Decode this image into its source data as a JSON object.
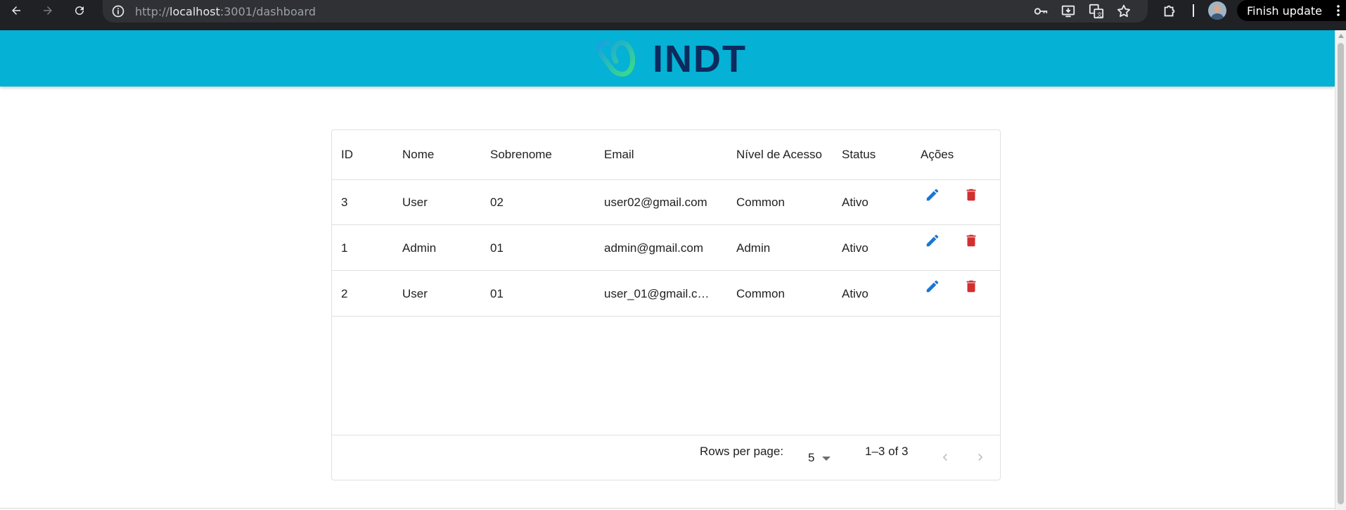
{
  "browser": {
    "url_scheme": "http://",
    "url_host": "localhost",
    "url_path": ":3001/dashboard",
    "finish_update_label": "Finish update"
  },
  "header": {
    "logo_text": "INDT",
    "brand_color": "#05b1d4"
  },
  "table": {
    "columns": [
      "ID",
      "Nome",
      "Sobrenome",
      "Email",
      "Nível de Acesso",
      "Status",
      "Ações"
    ],
    "rows": [
      {
        "id": "3",
        "nome": "User",
        "sobrenome": "02",
        "email": "user02@gmail.com",
        "nivel": "Common",
        "status": "Ativo"
      },
      {
        "id": "1",
        "nome": "Admin",
        "sobrenome": "01",
        "email": "admin@gmail.com",
        "nivel": "Admin",
        "status": "Ativo"
      },
      {
        "id": "2",
        "nome": "User",
        "sobrenome": "01",
        "email": "user_01@gmail.c…",
        "nivel": "Common",
        "status": "Ativo"
      }
    ],
    "edit_color": "#1976d2",
    "delete_color": "#d32f2f"
  },
  "pagination": {
    "rows_per_page_label": "Rows per page:",
    "rows_per_page_value": "5",
    "range_label": "1–3 of 3"
  }
}
